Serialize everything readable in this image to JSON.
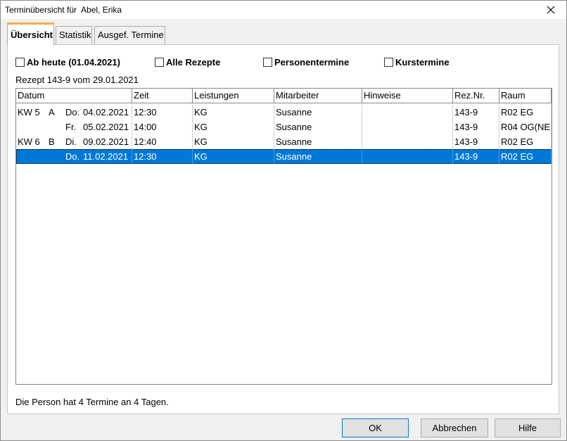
{
  "window": {
    "title": "Terminübersicht für  Abel, Erika"
  },
  "tabs": [
    {
      "label": "Übersicht"
    },
    {
      "label": "Statistik"
    },
    {
      "label": "Ausgef. Termine"
    }
  ],
  "filters": {
    "ab_heute": "Ab heute (01.04.2021)",
    "alle_rezepte": "Alle Rezepte",
    "personentermine": "Personentermine",
    "kurstermine": "Kurstermine"
  },
  "rezept_line": "Rezept 143-9 vom 29.01.2021",
  "table": {
    "columns": [
      "Datum",
      "Zeit",
      "Leistungen",
      "Mitarbeiter",
      "Hinweise",
      "Rez.Nr.",
      "Raum"
    ],
    "rows": [
      {
        "kw": "KW 5",
        "grp": "A",
        "day": "Do.",
        "date": "04.02.2021",
        "zeit": "12:30",
        "leistung": "KG",
        "mitarbeiter": "Susanne",
        "hinweise": "",
        "reznr": "143-9",
        "raum": "R02 EG"
      },
      {
        "kw": "",
        "grp": "",
        "day": "Fr.",
        "date": "05.02.2021",
        "zeit": "14:00",
        "leistung": "KG",
        "mitarbeiter": "Susanne",
        "hinweise": "",
        "reznr": "143-9",
        "raum": "R04 OG(NE"
      },
      {
        "kw": "KW 6",
        "grp": "B",
        "day": "Di.",
        "date": "09.02.2021",
        "zeit": "12:40",
        "leistung": "KG",
        "mitarbeiter": "Susanne",
        "hinweise": "",
        "reznr": "143-9",
        "raum": "R02 EG"
      },
      {
        "kw": "",
        "grp": "",
        "day": "Do.",
        "date": "11.02.2021",
        "zeit": "12:30",
        "leistung": "KG",
        "mitarbeiter": "Susanne",
        "hinweise": "",
        "reznr": "143-9",
        "raum": "R02 EG"
      }
    ],
    "selected_row": 3
  },
  "status": "Die Person hat 4 Termine an 4 Tagen.",
  "buttons": {
    "ok": "OK",
    "cancel": "Abbrechen",
    "help": "Hilfe"
  },
  "icons": {
    "close": "close-icon",
    "checkbox": "checkbox-icon"
  },
  "colors": {
    "selection": "#0078d7",
    "active_tab_accent": "#f0b24a",
    "panel_bg": "#ffffff",
    "window_bg": "#f0f0f0"
  }
}
